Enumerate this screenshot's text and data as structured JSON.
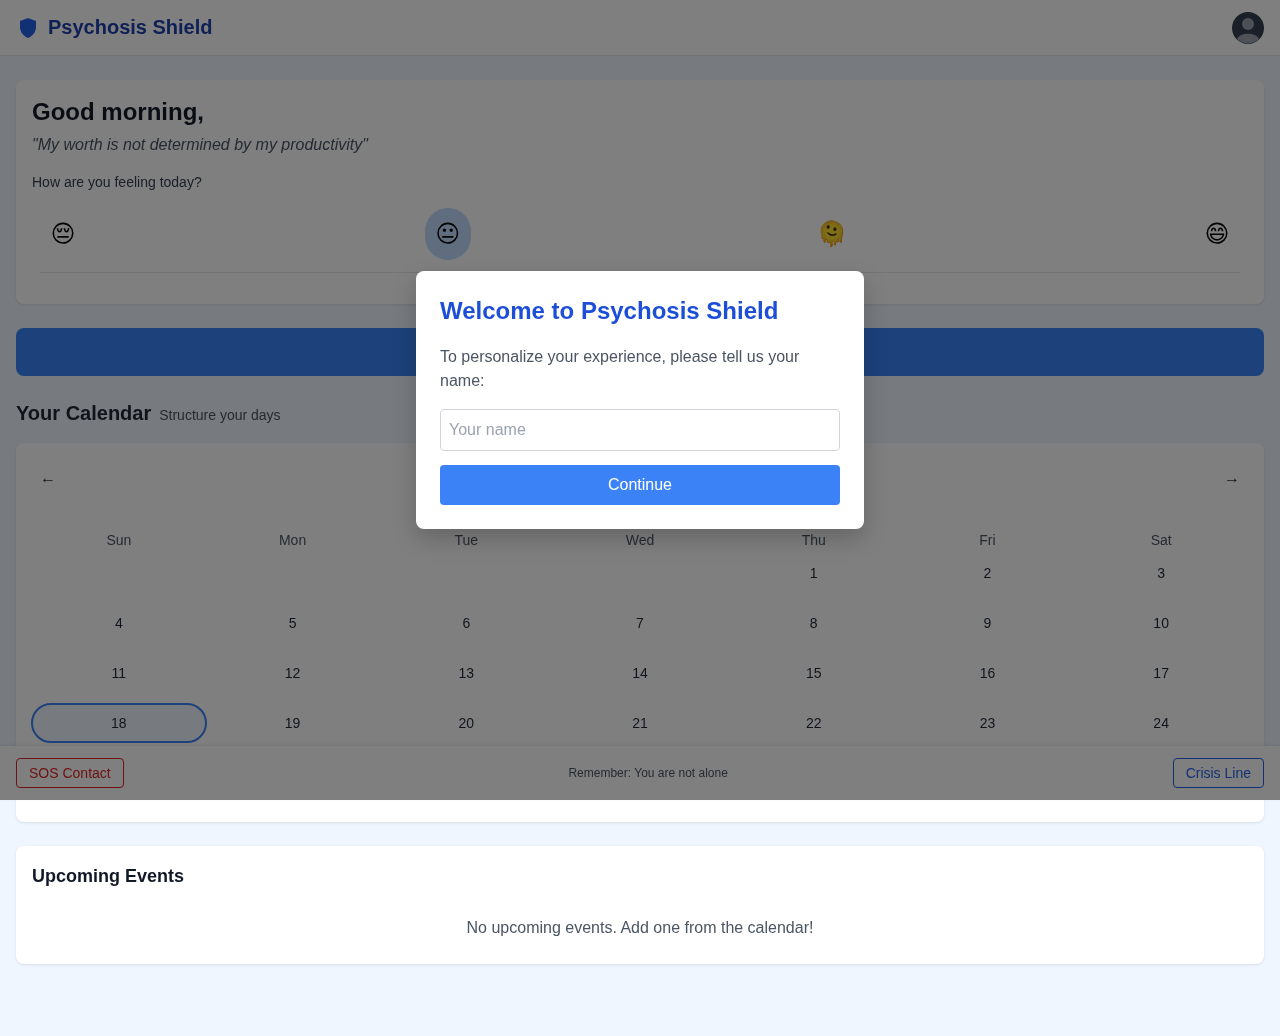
{
  "header": {
    "title": "Psychosis Shield"
  },
  "greeting": {
    "title": "Good morning,",
    "quote": "\"My worth is not determined by my productivity\"",
    "question": "How are you feeling today?",
    "moods": [
      {
        "emoji": "😔",
        "selected": false
      },
      {
        "emoji": "😐",
        "selected": true
      },
      {
        "emoji": "🫠",
        "selected": false
      },
      {
        "emoji": "😄",
        "selected": false
      }
    ]
  },
  "calendar": {
    "title": "Your Calendar",
    "subtitle": "Structure your days",
    "prev": "←",
    "next": "→",
    "weekdays": [
      "Sun",
      "Mon",
      "Tue",
      "Wed",
      "Thu",
      "Fri",
      "Sat"
    ],
    "weeks": [
      [
        {
          "day": "1",
          "today": false
        },
        {
          "day": "2",
          "today": false
        },
        {
          "day": "3",
          "today": false
        }
      ],
      [
        {
          "day": "4",
          "today": false
        },
        {
          "day": "5",
          "today": false
        },
        {
          "day": "6",
          "today": false
        },
        {
          "day": "7",
          "today": false
        },
        {
          "day": "8",
          "today": false
        },
        {
          "day": "9",
          "today": false
        },
        {
          "day": "10",
          "today": false
        }
      ],
      [
        {
          "day": "11",
          "today": false
        },
        {
          "day": "12",
          "today": false
        },
        {
          "day": "13",
          "today": false
        },
        {
          "day": "14",
          "today": false
        },
        {
          "day": "15",
          "today": false
        },
        {
          "day": "16",
          "today": false
        },
        {
          "day": "17",
          "today": false
        }
      ],
      [
        {
          "day": "18",
          "today": true
        },
        {
          "day": "19",
          "today": false
        },
        {
          "day": "20",
          "today": false
        },
        {
          "day": "21",
          "today": false
        },
        {
          "day": "22",
          "today": false
        },
        {
          "day": "23",
          "today": false
        },
        {
          "day": "24",
          "today": false
        }
      ]
    ]
  },
  "events": {
    "title": "Upcoming Events",
    "empty": "No upcoming events. Add one from the calendar!"
  },
  "footer": {
    "sos": "SOS Contact",
    "message": "Remember: You are not alone",
    "crisis": "Crisis Line"
  },
  "modal": {
    "title": "Welcome to Psychosis Shield",
    "text": "To personalize your experience, please tell us your name:",
    "placeholder": "Your name",
    "button": "Continue"
  }
}
